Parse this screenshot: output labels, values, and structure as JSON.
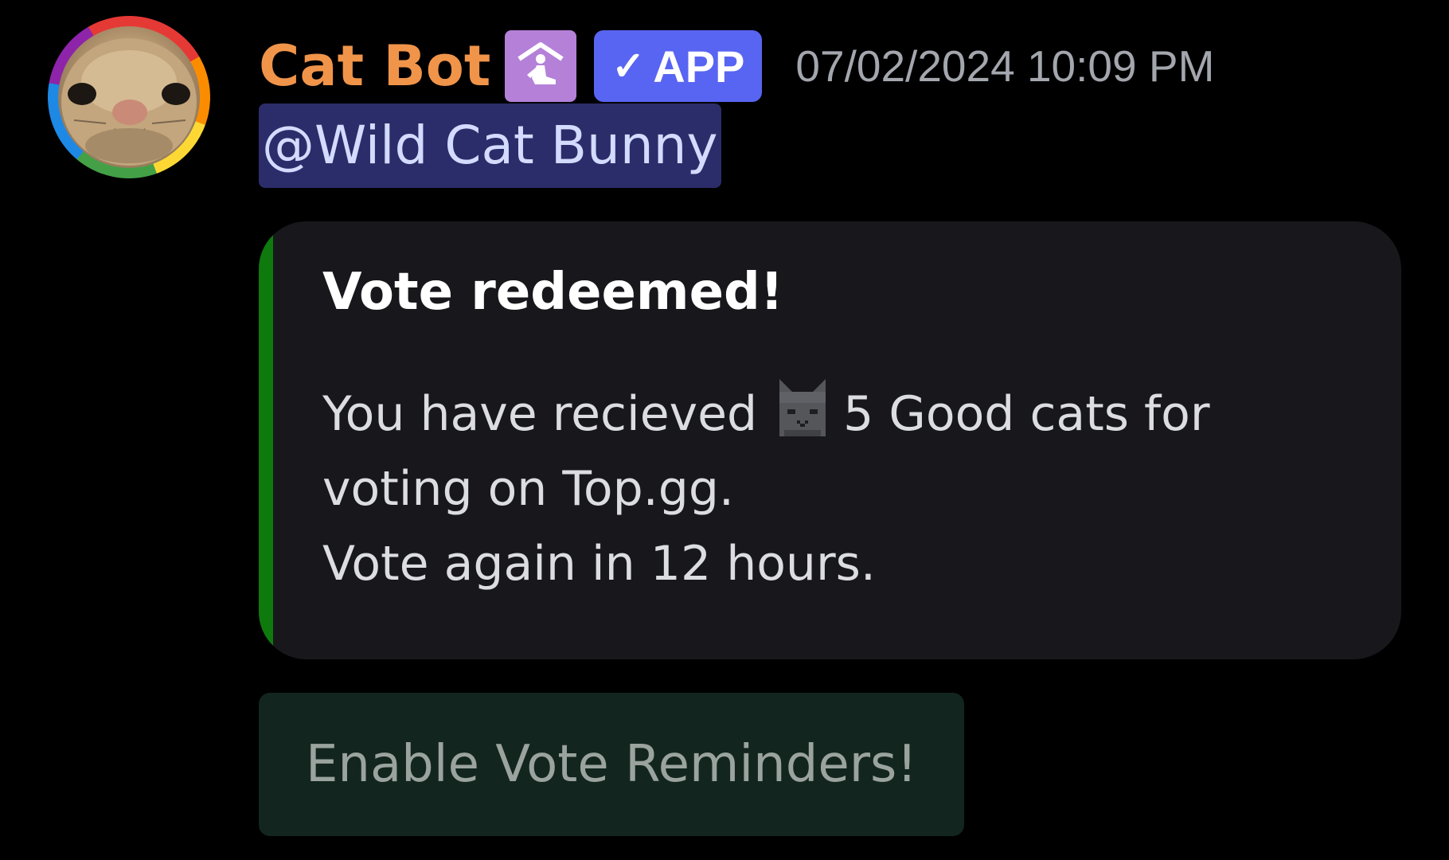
{
  "message": {
    "author": {
      "name": "Cat Bot",
      "name_color": "#f0944a",
      "avatar_icon": "cat-face-avatar",
      "role_icon": "kneeling-figure-icon",
      "badge": {
        "check": "✓",
        "label": "APP",
        "color": "#5865f2"
      }
    },
    "timestamp": "07/02/2024 10:09 PM",
    "mention": "@Wild Cat Bunny",
    "embed": {
      "accent_color": "#0e7a0e",
      "title": "Vote redeemed!",
      "line1_prefix": "You have recieved",
      "emoji": "good-cat-emoji",
      "line1_suffix": "5 Good cats for",
      "line2": "voting on Top.gg.",
      "line3": "Vote again in 12 hours."
    },
    "button": {
      "label": "Enable Vote Reminders!"
    }
  }
}
